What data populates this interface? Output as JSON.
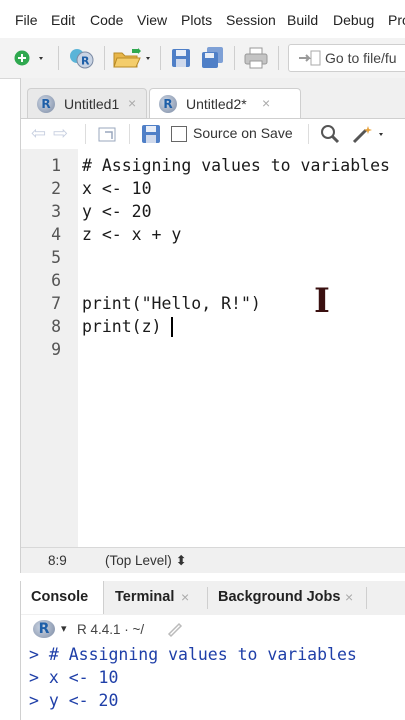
{
  "menu": [
    "File",
    "Edit",
    "Code",
    "View",
    "Plots",
    "Session",
    "Build",
    "Debug",
    "Pro"
  ],
  "toolbar": {
    "goto_placeholder": "Go to file/fu"
  },
  "tabs": [
    {
      "label": "Untitled1",
      "close": "×"
    },
    {
      "label": "Untitled2*",
      "close": "×"
    }
  ],
  "editor_toolbar": {
    "source_on_save": "Source on Save"
  },
  "editor": {
    "line_numbers": [
      "1",
      "2",
      "3",
      "4",
      "5",
      "6",
      "7",
      "8",
      "9"
    ],
    "lines": [
      "# Assigning values to variables",
      "x <- 10",
      "y <- 20",
      "z <- x + y",
      "",
      "",
      "print(\"Hello, R!\")",
      "print(z)",
      ""
    ]
  },
  "status": {
    "position": "8:9",
    "scope": "(Top Level) ⬍"
  },
  "console": {
    "tabs": [
      {
        "label": "Console"
      },
      {
        "label": "Terminal",
        "close": "×"
      },
      {
        "label": "Background Jobs",
        "close": "×"
      }
    ],
    "r_version": "R 4.4.1 · ~/",
    "output": [
      "> # Assigning values to variables",
      "> x <- 10",
      "> y <- 20"
    ]
  },
  "colors": {
    "console_text": "#1f3fa8",
    "panel_bg": "#f0f0f0",
    "accent": "#2a7fd4"
  },
  "icons": [
    "new-file-icon",
    "project-icon",
    "open-folder-icon",
    "save-icon",
    "save-all-icon",
    "print-icon",
    "goto-file-icon",
    "r-logo-icon",
    "back-arrow-icon",
    "forward-arrow-icon",
    "show-in-window-icon",
    "search-icon",
    "magic-wand-icon",
    "text-cursor-icon",
    "refresh-icon"
  ]
}
